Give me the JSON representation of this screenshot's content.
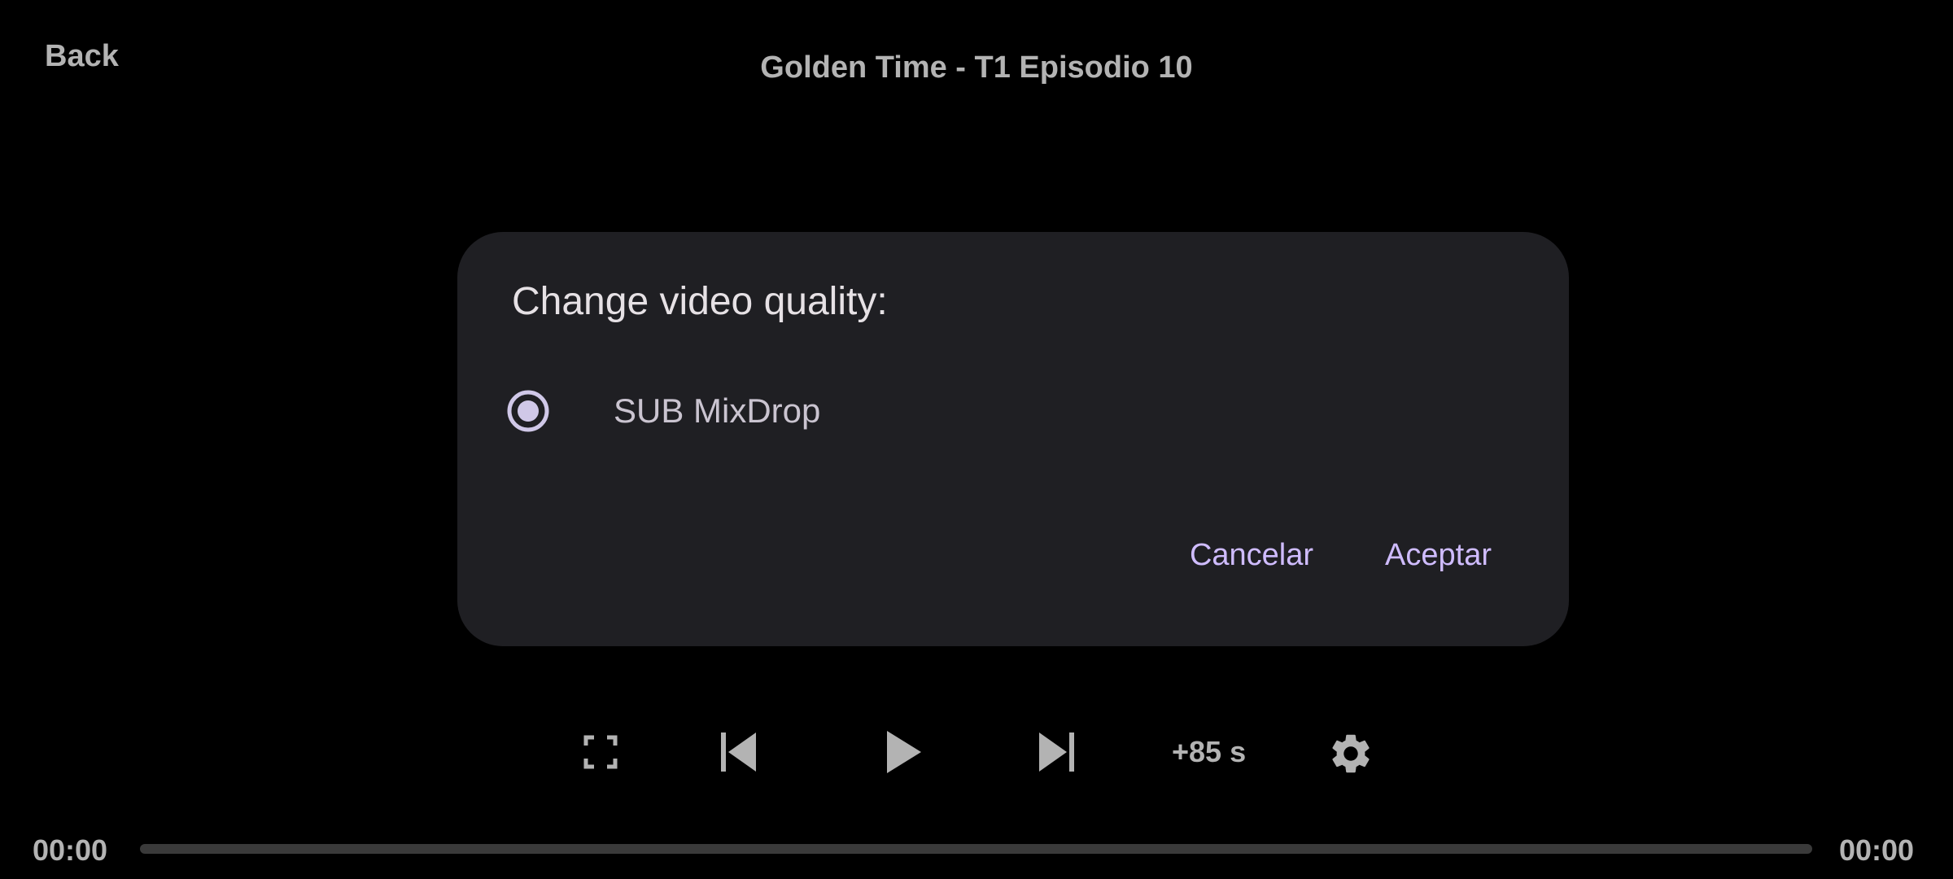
{
  "header": {
    "back_label": "Back",
    "title": "Golden Time - T1 Episodio 10"
  },
  "dialog": {
    "title": "Change video quality:",
    "options": [
      {
        "label": "SUB MixDrop",
        "selected": true
      }
    ],
    "cancel_label": "Cancelar",
    "accept_label": "Aceptar"
  },
  "controls": {
    "icons": [
      "fullscreen-icon",
      "skip-previous-icon",
      "play-icon",
      "skip-next-icon",
      "settings-icon"
    ],
    "skip_label": "+85 s"
  },
  "timeline": {
    "current_time": "00:00",
    "total_time": "00:00",
    "progress": 0
  },
  "colors": {
    "background": "#000000",
    "dialog_background": "#1f1f23",
    "accent": "#cfbcff",
    "control": "#b3b3b3"
  }
}
